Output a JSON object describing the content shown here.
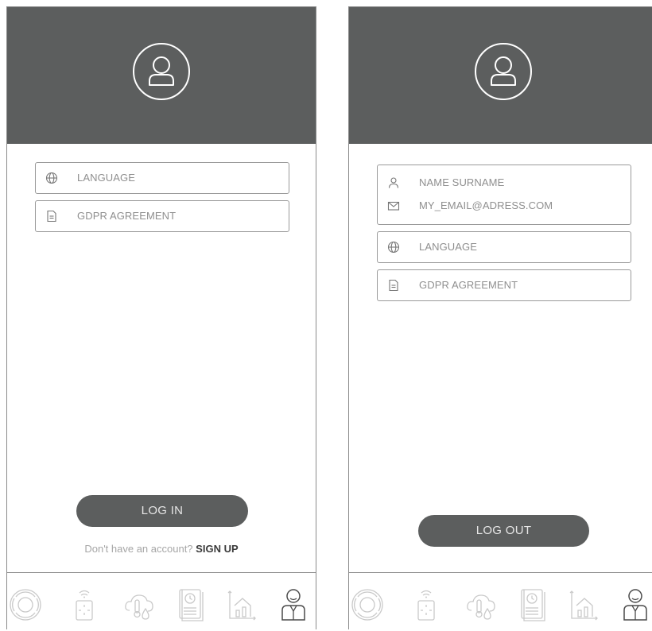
{
  "screens": [
    {
      "id": "logged-out",
      "fields": [
        {
          "rows": [
            {
              "icon": "globe-icon",
              "label": "LANGUAGE"
            }
          ]
        },
        {
          "rows": [
            {
              "icon": "document-icon",
              "label": "GDPR AGREEMENT"
            }
          ]
        }
      ],
      "button_label": "LOG IN",
      "signup_prompt": "Don't have an account?",
      "signup_link": "SIGN UP"
    },
    {
      "id": "logged-in",
      "fields": [
        {
          "rows": [
            {
              "icon": "person-icon",
              "label": "NAME SURNAME"
            },
            {
              "icon": "mail-icon",
              "label": "MY_EMAIL@ADRESS.COM"
            }
          ]
        },
        {
          "rows": [
            {
              "icon": "globe-icon",
              "label": "LANGUAGE"
            }
          ]
        },
        {
          "rows": [
            {
              "icon": "document-icon",
              "label": "GDPR AGREEMENT"
            }
          ]
        }
      ],
      "button_label": "LOG OUT"
    }
  ],
  "tabbar": {
    "tabs": [
      "control-dial-icon",
      "remote-sensor-icon",
      "weather-thermometer-icon",
      "report-clock-icon",
      "chart-house-icon",
      "profile-icon"
    ],
    "active": "profile-icon"
  },
  "colors": {
    "header": "#5c5e5e",
    "button": "#5c5e5e",
    "border": "#9a9a9a",
    "label": "#8f8f8f",
    "icon_inactive": "#c9c9c9",
    "icon_active": "#4a4a4a"
  }
}
